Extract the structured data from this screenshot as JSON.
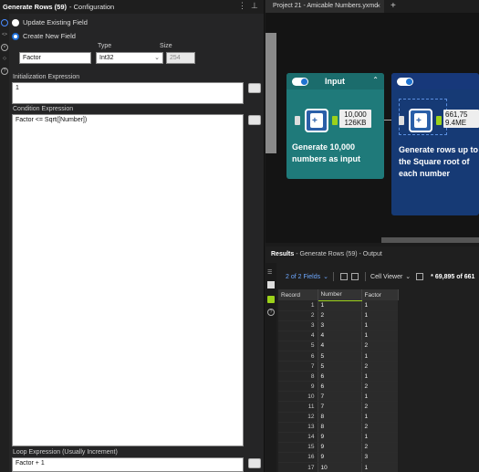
{
  "config": {
    "title_bold": "Generate Rows (59)",
    "title_rest": "- Configuration",
    "radio_update": "Update Existing Field",
    "radio_create": "Create New  Field",
    "field_name": "Factor",
    "type_label": "Type",
    "type_value": "Int32",
    "size_label": "Size",
    "size_value": "254",
    "init_label": "Initialization Expression",
    "init_value": "1",
    "cond_label": "Condition Expression",
    "cond_value": "Factor <= Sqrt([Number])",
    "loop_label": "Loop Expression (Usually Increment)",
    "loop_value": "Factor + 1"
  },
  "workflow": {
    "tab_title": "Project 21 - Amicable Numbers.yxmd",
    "tab_close": "×",
    "tab_plus": "+",
    "container1_title": "Input",
    "badge1_line1": "10,000",
    "badge1_line2": "126KB",
    "anno1": "Generate 10,000 numbers as input",
    "badge2_line1": "661,75",
    "badge2_line2": "9.4ME",
    "anno2": "Generate rows up to the Square root of each number"
  },
  "results": {
    "title_bold": "Results",
    "title_rest": "- Generate Rows (59) - Output",
    "fields": "2 of 2 Fields",
    "viewer": "Cell Viewer",
    "info": "* 69,895 of 661",
    "columns": [
      "Record",
      "Number",
      "Factor"
    ],
    "rows": [
      [
        "1",
        "1",
        "1"
      ],
      [
        "2",
        "2",
        "1"
      ],
      [
        "3",
        "3",
        "1"
      ],
      [
        "4",
        "4",
        "1"
      ],
      [
        "5",
        "4",
        "2"
      ],
      [
        "6",
        "5",
        "1"
      ],
      [
        "7",
        "5",
        "2"
      ],
      [
        "8",
        "6",
        "1"
      ],
      [
        "9",
        "6",
        "2"
      ],
      [
        "10",
        "7",
        "1"
      ],
      [
        "11",
        "7",
        "2"
      ],
      [
        "12",
        "8",
        "1"
      ],
      [
        "13",
        "8",
        "2"
      ],
      [
        "14",
        "9",
        "1"
      ],
      [
        "15",
        "9",
        "2"
      ],
      [
        "16",
        "9",
        "3"
      ],
      [
        "17",
        "10",
        "1"
      ]
    ]
  }
}
